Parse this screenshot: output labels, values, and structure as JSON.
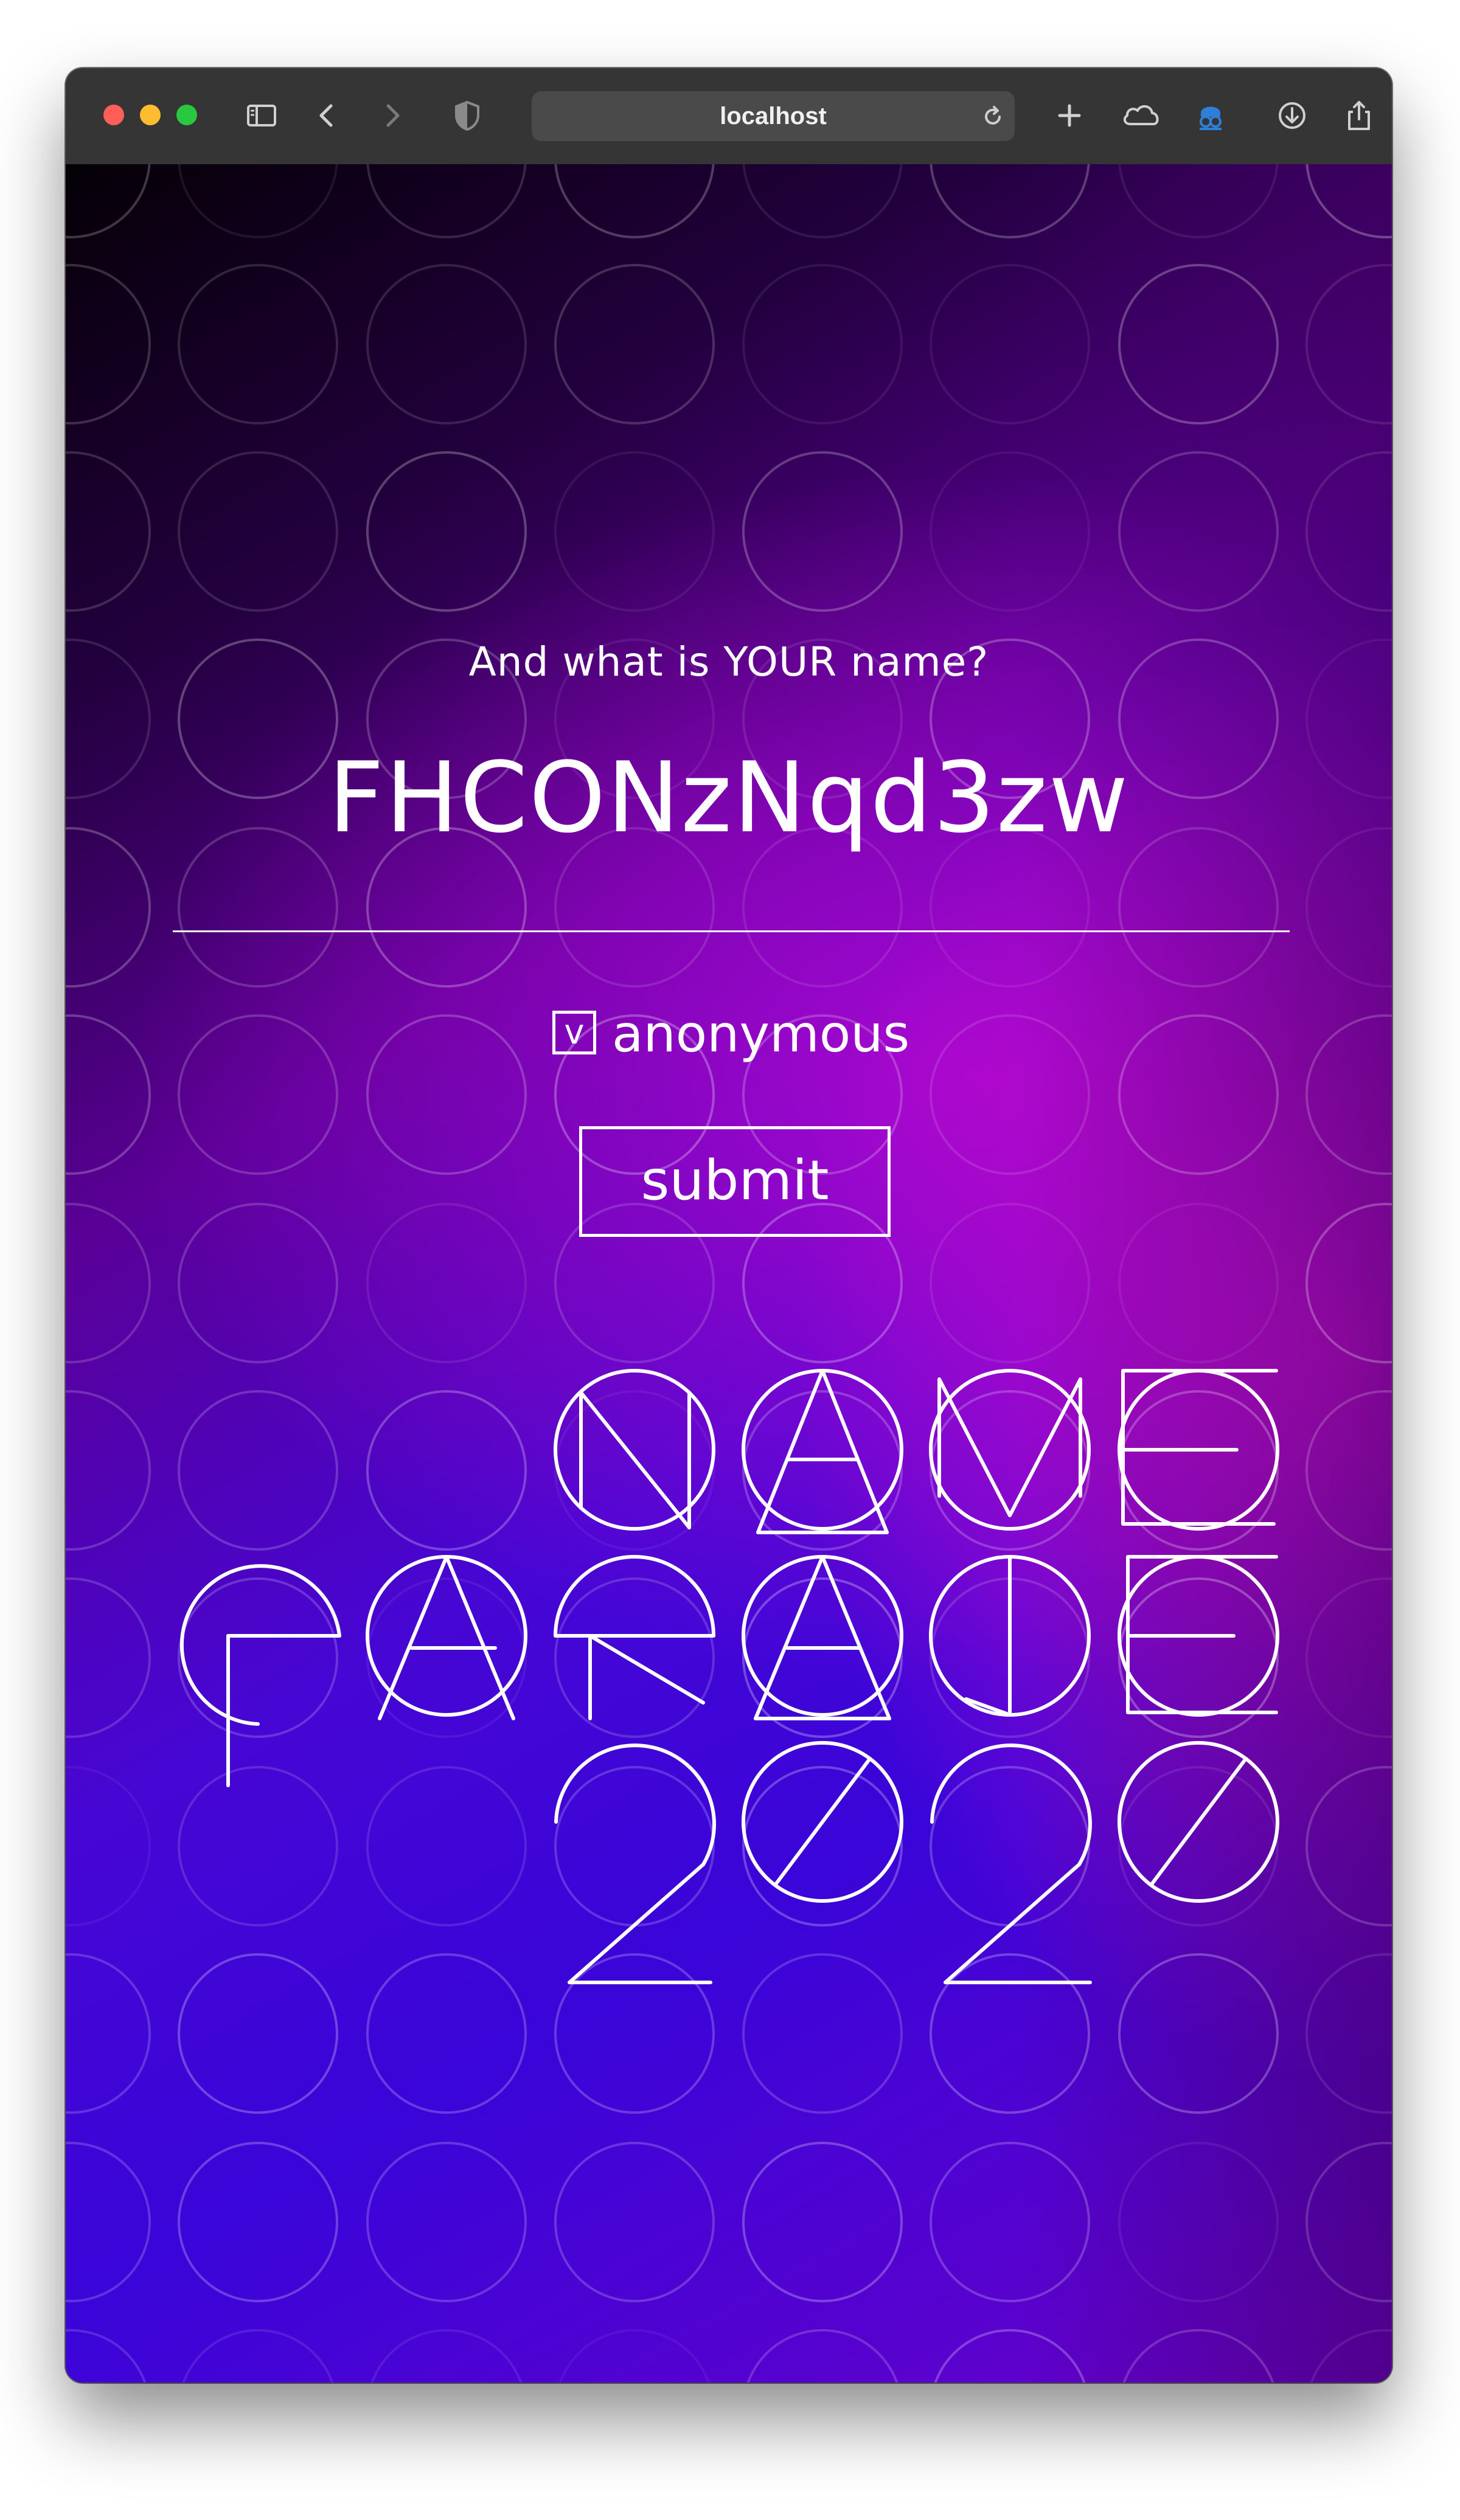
{
  "browser": {
    "url": "localhost",
    "traffic_lights": [
      "#ff5f57",
      "#febc2e",
      "#28c840"
    ],
    "icons": [
      "sidebar-icon",
      "back-icon",
      "forward-icon",
      "shield-icon",
      "reload-icon",
      "new-tab-icon",
      "cloud-icon",
      "extension-icon",
      "download-icon",
      "share-icon"
    ]
  },
  "form": {
    "question": "And what is YOUR name?",
    "name_value": "FHCONzNqd3zw",
    "anonymous_checked": true,
    "checkbox_mark": "v",
    "anonymous_label": "anonymous",
    "submit_label": "submit"
  },
  "logo": {
    "lines": [
      "NAME",
      "PARADE",
      "2020"
    ]
  },
  "colors": {
    "text": "#ffffff",
    "gradient_dark": "#050006",
    "gradient_purple": "#4606d4",
    "gradient_magenta": "#cf0fd6"
  }
}
